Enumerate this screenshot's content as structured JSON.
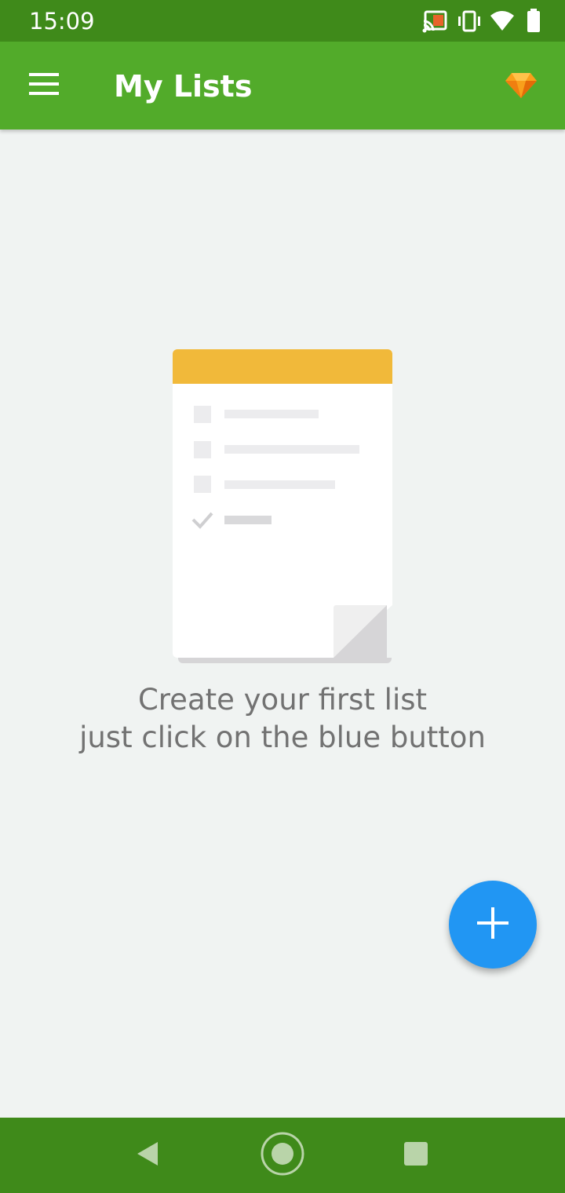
{
  "status_bar": {
    "time": "15:09",
    "icons": [
      "cast-icon",
      "vibrate-icon",
      "wifi-icon",
      "battery-icon"
    ]
  },
  "app_bar": {
    "title": "My Lists",
    "menu_icon": "hamburger-menu-icon",
    "premium_icon": "diamond-icon"
  },
  "empty_state": {
    "line1": "Create your first list",
    "line2": "just click on the blue button"
  },
  "fab": {
    "icon": "plus-icon"
  },
  "nav_bar": {
    "buttons": [
      "back-icon",
      "home-icon",
      "recents-icon"
    ]
  },
  "colors": {
    "status_bar": "#3f8a1a",
    "app_bar": "#52ab2a",
    "background": "#f0f3f2",
    "fab": "#2196f3",
    "note_header": "#f1b93a",
    "diamond": "#f9a01b"
  }
}
